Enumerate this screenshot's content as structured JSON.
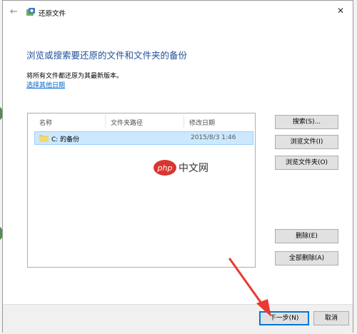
{
  "window": {
    "title": "还原文件"
  },
  "heading": "浏览或搜索要还原的文件和文件夹的备份",
  "description": "将所有文件都还原为其最新版本。",
  "choose_date_link": "选择其他日期",
  "list": {
    "columns": [
      "名称",
      "文件夹路径",
      "修改日期"
    ],
    "rows": [
      {
        "name": "C: 的备份",
        "path": "",
        "modified": "2015/8/3 1:46"
      }
    ]
  },
  "side_buttons": {
    "search": "搜索(S)...",
    "browse_files": "浏览文件(I)",
    "browse_folders": "浏览文件夹(O)",
    "remove": "删除(E)",
    "remove_all": "全部删除(A)"
  },
  "footer": {
    "next": "下一步(N)",
    "cancel": "取消"
  },
  "watermark": {
    "php": "php",
    "cn": "中文网"
  },
  "colors": {
    "heading": "#1f4f9a",
    "link": "#0066cc",
    "selection": "#cce8ff",
    "annotation_arrow": "#e83a2e",
    "watermark_logo": "#d9362f"
  },
  "icons": [
    "back-arrow-icon",
    "restore-app-icon",
    "close-icon",
    "folder-icon"
  ]
}
